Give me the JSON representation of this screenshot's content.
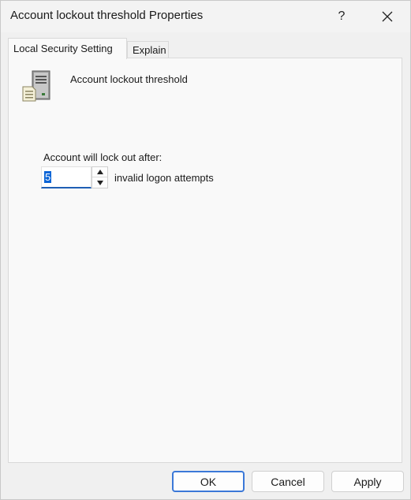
{
  "window": {
    "title": "Account lockout threshold Properties",
    "help_glyph": "?"
  },
  "tabs": [
    {
      "label": "Local Security Setting",
      "active": true
    },
    {
      "label": "Explain",
      "active": false
    }
  ],
  "policy": {
    "icon": "server-document-icon",
    "name": "Account lockout threshold"
  },
  "setting": {
    "label": "Account will lock out after:",
    "value": "5",
    "unit_label": "invalid logon attempts"
  },
  "buttons": {
    "ok": "OK",
    "cancel": "Cancel",
    "apply": "Apply"
  },
  "colors": {
    "accent": "#0a64d6",
    "focus_border": "#3b78d8"
  }
}
